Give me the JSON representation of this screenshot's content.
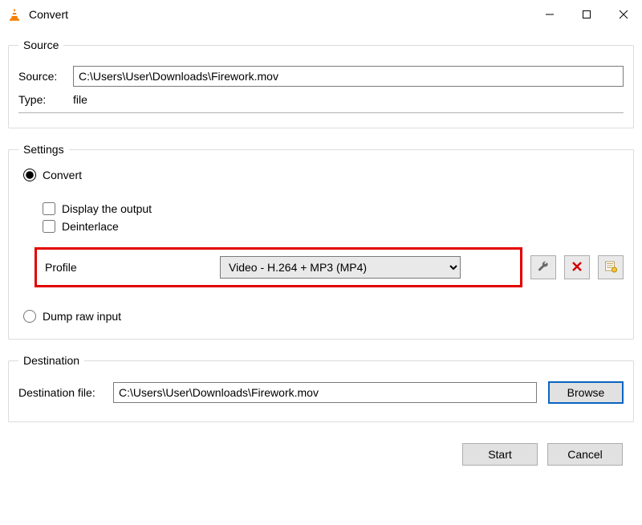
{
  "window": {
    "title": "Convert"
  },
  "source_group": {
    "legend": "Source",
    "source_label": "Source:",
    "source_value": "C:\\Users\\User\\Downloads\\Firework.mov",
    "type_label": "Type:",
    "type_value": "file"
  },
  "settings_group": {
    "legend": "Settings",
    "convert_label": "Convert",
    "display_output_label": "Display the output",
    "deinterlace_label": "Deinterlace",
    "profile_label": "Profile",
    "profile_value": "Video - H.264 + MP3 (MP4)",
    "dump_raw_label": "Dump raw input"
  },
  "destination_group": {
    "legend": "Destination",
    "dest_label": "Destination file:",
    "dest_value": "C:\\Users\\User\\Downloads\\Firework.mov",
    "browse_label": "Browse"
  },
  "footer": {
    "start_label": "Start",
    "cancel_label": "Cancel"
  }
}
